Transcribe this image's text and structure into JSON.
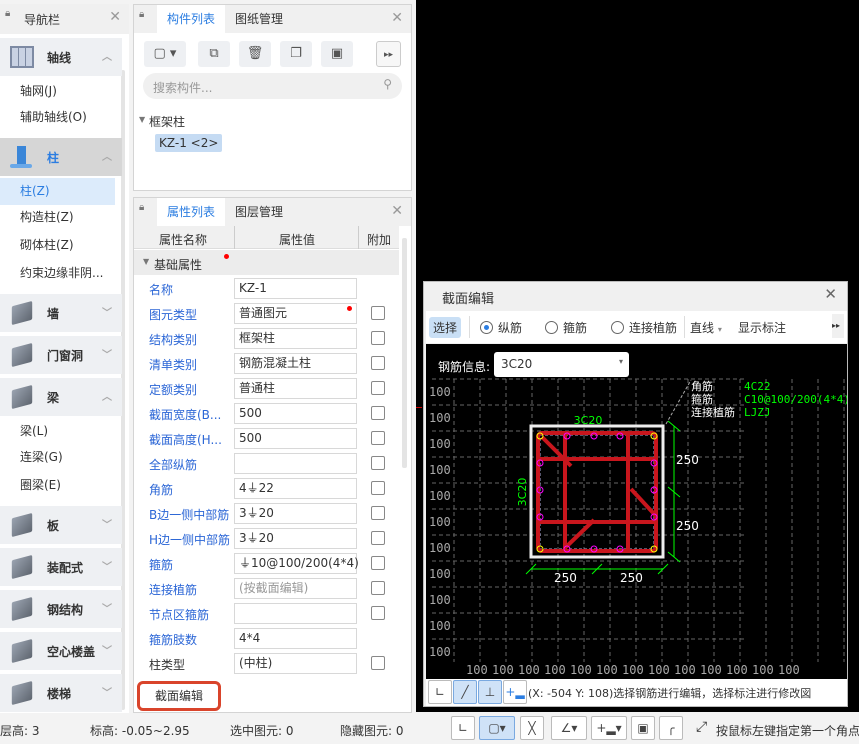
{
  "nav": {
    "title": "导航栏",
    "groups": [
      {
        "label": "轴线",
        "items": [
          "轴网(J)",
          "辅助轴线(O)"
        ]
      },
      {
        "label": "柱",
        "items": [
          "柱(Z)",
          "构造柱(Z)",
          "砌体柱(Z)",
          "约束边缘非阴..."
        ]
      },
      {
        "label": "墙"
      },
      {
        "label": "门窗洞"
      },
      {
        "label": "梁",
        "items": [
          "梁(L)",
          "连梁(G)",
          "圈梁(E)"
        ]
      },
      {
        "label": "板"
      },
      {
        "label": "装配式"
      },
      {
        "label": "钢结构"
      },
      {
        "label": "空心楼盖"
      },
      {
        "label": "楼梯"
      }
    ]
  },
  "component_panel": {
    "tabs": [
      "构件列表",
      "图纸管理"
    ],
    "search_placeholder": "搜索构件...",
    "tree_group": "框架柱",
    "tree_item": "KZ-1 <2>"
  },
  "property_panel": {
    "tabs": [
      "属性列表",
      "图层管理"
    ],
    "headers": [
      "属性名称",
      "属性值",
      "附加"
    ],
    "group": "基础属性",
    "rows": [
      {
        "name": "名称",
        "value": "KZ-1"
      },
      {
        "name": "图元类型",
        "value": "普通图元"
      },
      {
        "name": "结构类别",
        "value": "框架柱"
      },
      {
        "name": "清单类别",
        "value": "钢筋混凝土柱"
      },
      {
        "name": "定额类别",
        "value": "普通柱"
      },
      {
        "name": "截面宽度(B...",
        "value": "500"
      },
      {
        "name": "截面高度(H...",
        "value": "500"
      },
      {
        "name": "全部纵筋",
        "value": ""
      },
      {
        "name": "角筋",
        "value": "4⏚22"
      },
      {
        "name": "B边一侧中部筋",
        "value": "3⏚20"
      },
      {
        "name": "H边一侧中部筋",
        "value": "3⏚20"
      },
      {
        "name": "箍筋",
        "value": "⏚10@100/200(4*4)"
      },
      {
        "name": "连接植筋",
        "value": "(按截面编辑)"
      },
      {
        "name": "节点区箍筋",
        "value": ""
      },
      {
        "name": "箍筋肢数",
        "value": "4*4"
      },
      {
        "name": "柱类型",
        "value": "(中柱)"
      }
    ],
    "section_edit_button": "截面编辑"
  },
  "dialog": {
    "title": "截面编辑",
    "toolbar": {
      "select": "选择",
      "radio_longitudinal": "纵筋",
      "radio_stirrup": "箍筋",
      "radio_anchor": "连接植筋",
      "line_mode": "直线",
      "show_label": "显示标注"
    },
    "rebar_info_label": "钢筋信息:",
    "rebar_info_value": "3C20",
    "legend": [
      {
        "name": "角筋",
        "value": "4C22"
      },
      {
        "name": "箍筋",
        "value": "C10@100/200(4*4)"
      },
      {
        "name": "连接植筋",
        "value": "LJZJ"
      }
    ],
    "grid_label": "100",
    "top_label": "3C20",
    "side_label": "3C20",
    "dim": "250",
    "status": "(X: -504 Y: 108)选择钢筋进行编辑，选择标注进行修改図"
  },
  "statusbar": {
    "floor_height": "层高:  3",
    "elevation": "标高:  -0.05~2.95",
    "selected": "选中图元:  0",
    "hidden": "隐藏图元:  0",
    "hint": "按鼠标左键指定第一个角点"
  },
  "colors": {
    "accent": "#2b7de1",
    "rebar": "#c8161d",
    "dim": "#00ff00",
    "highlight": "#d9442b"
  }
}
